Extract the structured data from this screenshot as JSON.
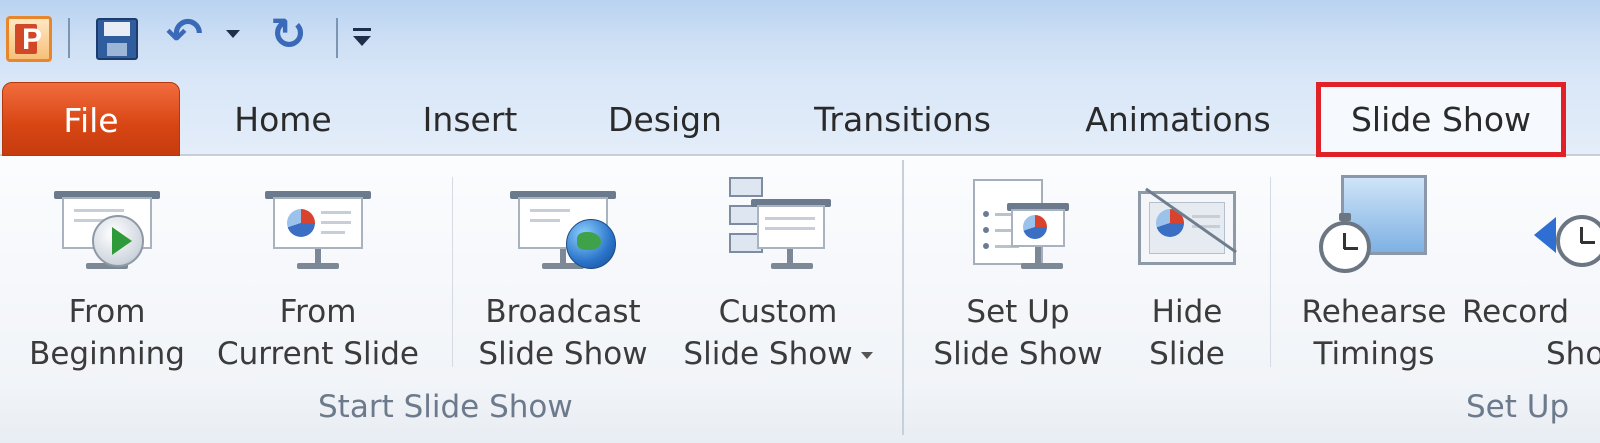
{
  "app": {
    "logo_letter": "P"
  },
  "quick_access": {
    "icons": [
      "powerpoint-logo-icon",
      "save-icon",
      "undo-icon",
      "dropdown-arrow-icon",
      "redo-icon",
      "customize-toolbar-icon"
    ]
  },
  "tabs": [
    {
      "label": "File",
      "active": false
    },
    {
      "label": "Home",
      "active": false
    },
    {
      "label": "Insert",
      "active": false
    },
    {
      "label": "Design",
      "active": false
    },
    {
      "label": "Transitions",
      "active": false
    },
    {
      "label": "Animations",
      "active": false
    },
    {
      "label": "Slide Show",
      "active": true,
      "highlighted": true
    }
  ],
  "colors": {
    "file_tab": "#d74513",
    "highlight_border": "#e02228",
    "group_label": "#6c7a8c"
  },
  "groups": {
    "start_slide_show": {
      "label": "Start Slide Show",
      "buttons": {
        "from_beginning": {
          "line1": "From",
          "line2": "Beginning",
          "icon": "play-from-start-icon"
        },
        "from_current": {
          "line1": "From",
          "line2": "Current Slide",
          "icon": "slide-screen-icon"
        },
        "broadcast": {
          "line1": "Broadcast",
          "line2": "Slide Show",
          "icon": "broadcast-globe-icon"
        },
        "custom": {
          "line1": "Custom",
          "line2": "Slide Show",
          "icon": "custom-show-icon",
          "has_dropdown": true
        }
      }
    },
    "set_up": {
      "label": "Set Up",
      "buttons": {
        "set_up_show": {
          "line1": "Set Up",
          "line2": "Slide Show",
          "icon": "setup-show-icon"
        },
        "hide_slide": {
          "line1": "Hide",
          "line2": "Slide",
          "icon": "hide-slide-icon"
        },
        "rehearse": {
          "line1": "Rehearse",
          "line2": "Timings",
          "icon": "stopwatch-icon"
        },
        "record": {
          "line1": "Record",
          "line2": "Show",
          "icon": "record-show-icon"
        }
      }
    }
  }
}
